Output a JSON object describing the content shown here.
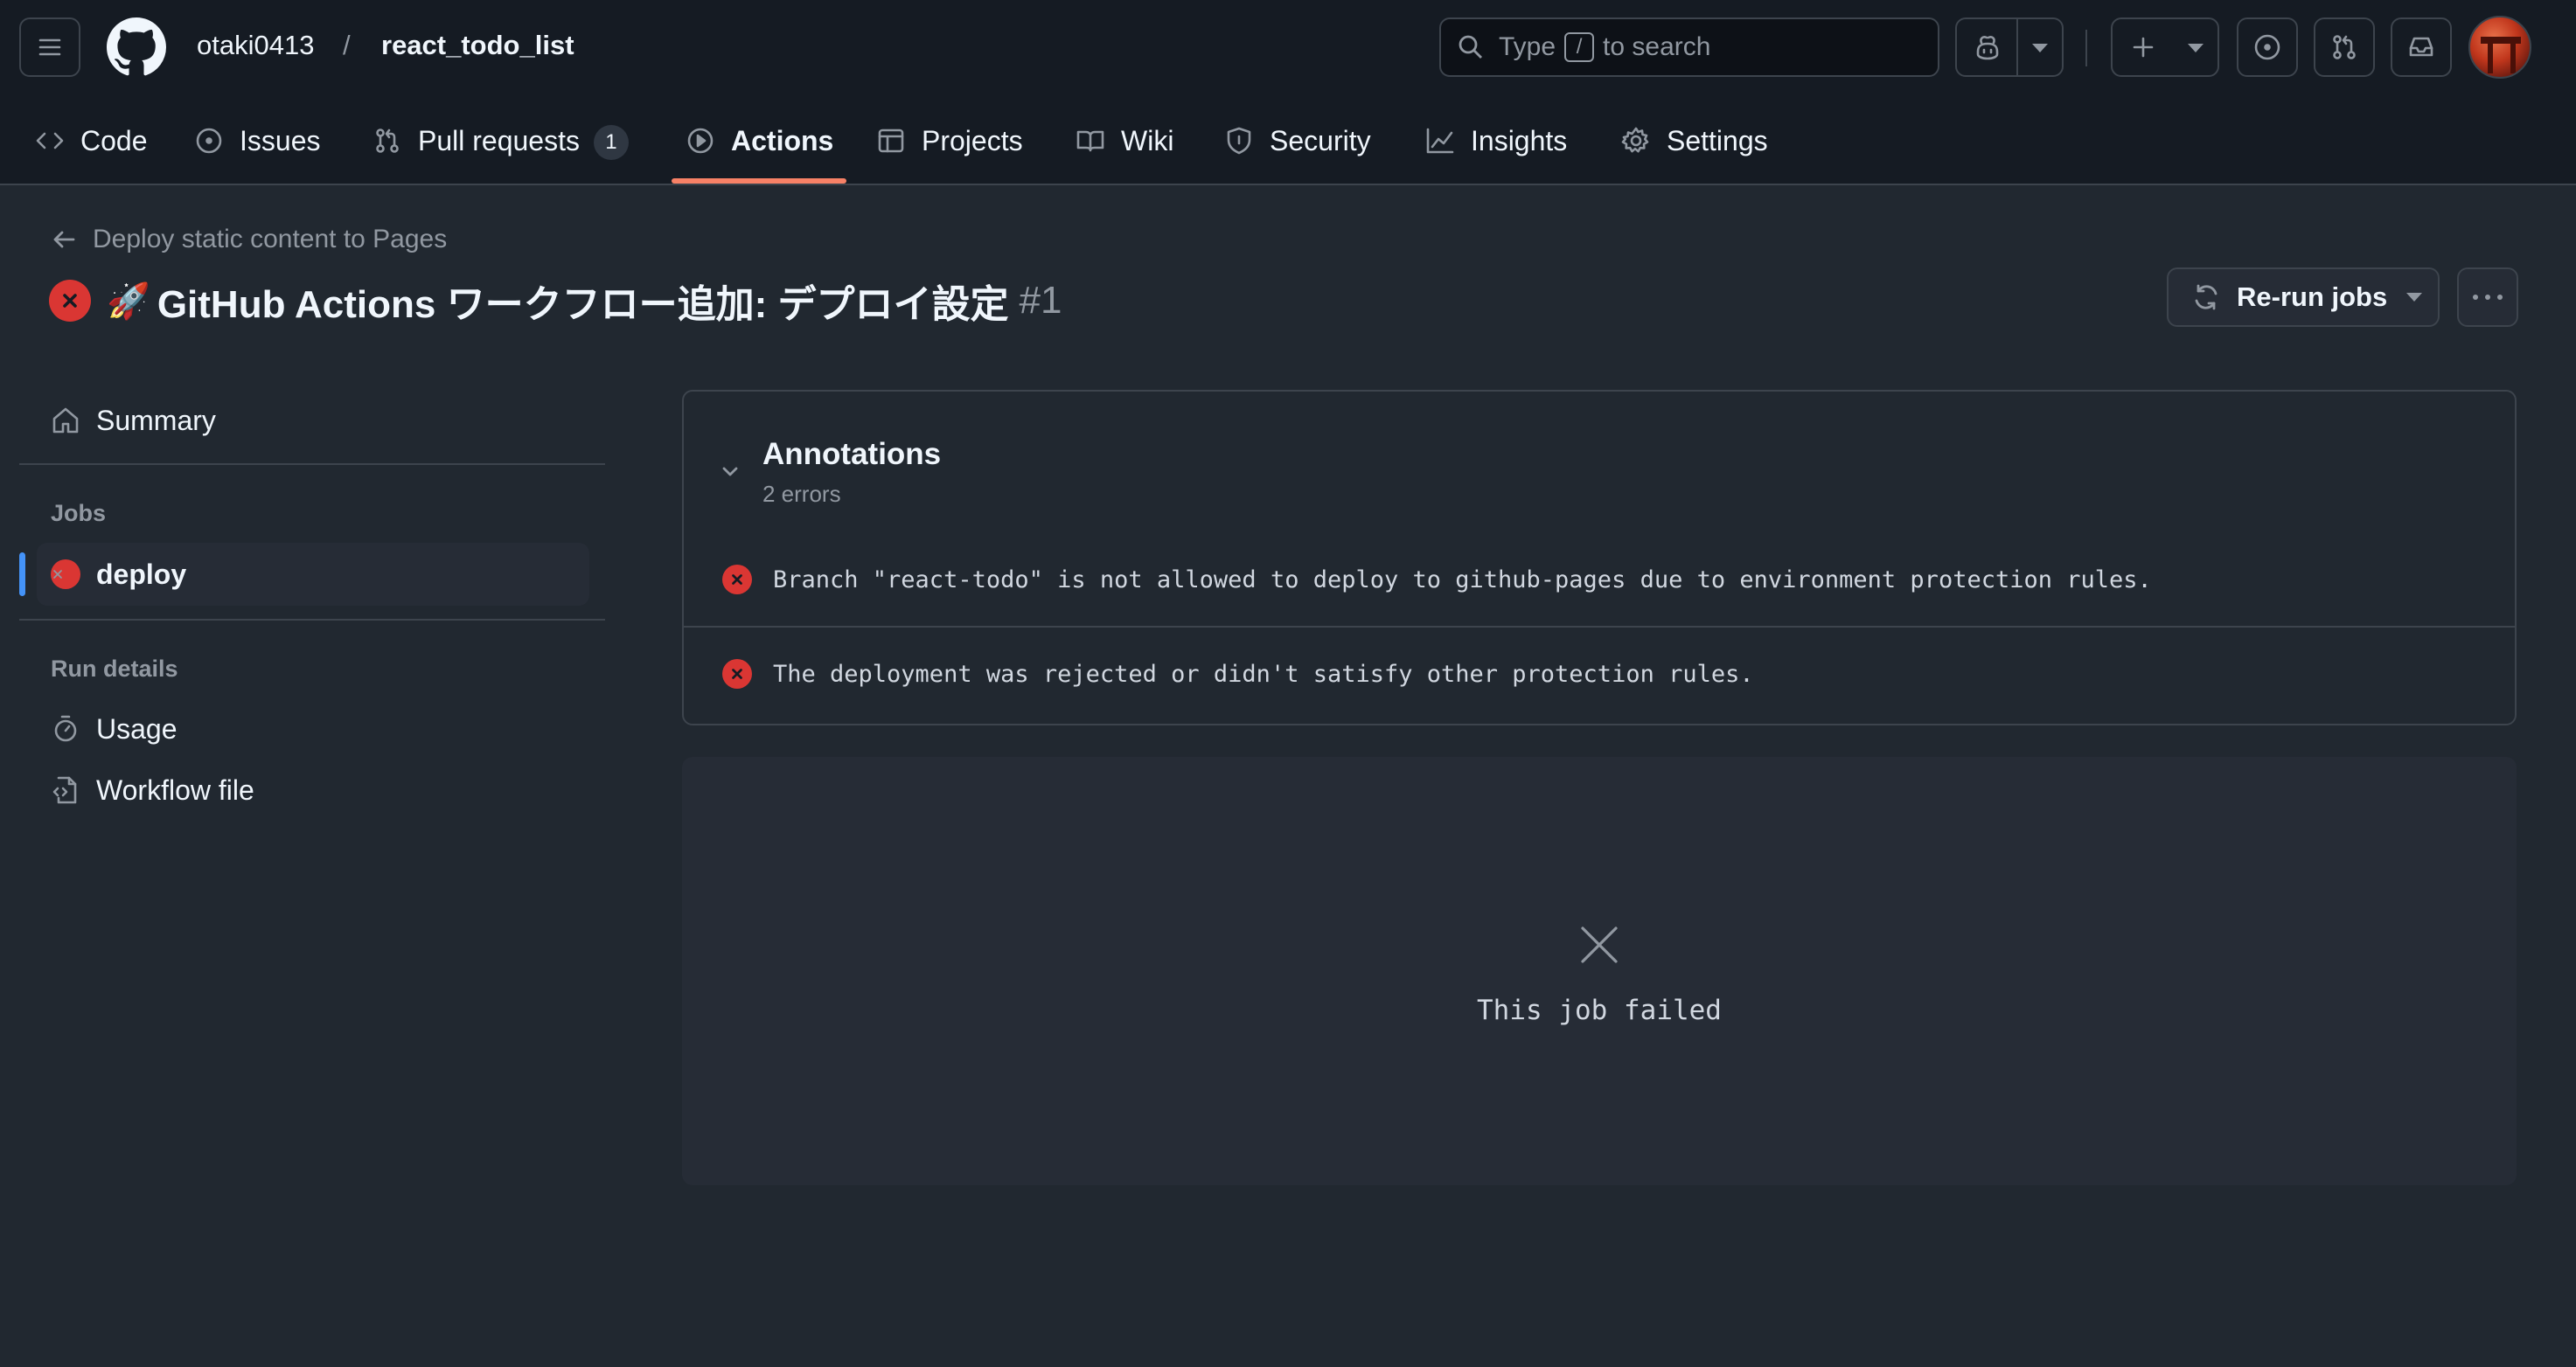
{
  "header": {
    "owner": "otaki0413",
    "separator": "/",
    "repo": "react_todo_list",
    "search": {
      "prefix": "Type",
      "key": "/",
      "suffix": "to search"
    }
  },
  "tabs": [
    {
      "label": "Code",
      "icon": "code-icon"
    },
    {
      "label": "Issues",
      "icon": "issue-icon"
    },
    {
      "label": "Pull requests",
      "icon": "pull-request-icon",
      "count": "1"
    },
    {
      "label": "Actions",
      "icon": "play-icon",
      "active": true
    },
    {
      "label": "Projects",
      "icon": "table-icon"
    },
    {
      "label": "Wiki",
      "icon": "book-icon"
    },
    {
      "label": "Security",
      "icon": "shield-icon"
    },
    {
      "label": "Insights",
      "icon": "graph-icon"
    },
    {
      "label": "Settings",
      "icon": "gear-icon"
    }
  ],
  "run": {
    "back_link": "Deploy static content to Pages",
    "emoji": "🚀",
    "title": "GitHub Actions ワークフロー追加: デプロイ設定",
    "number": "#1",
    "status": "failure",
    "rerun_label": "Re-run jobs"
  },
  "sidebar": {
    "summary": "Summary",
    "jobs_heading": "Jobs",
    "job": "deploy",
    "run_details_heading": "Run details",
    "usage": "Usage",
    "workflow_file": "Workflow file"
  },
  "annotations": {
    "title": "Annotations",
    "subtitle": "2 errors",
    "items": [
      "Branch \"react-todo\" is not allowed to deploy to github-pages due to environment protection rules.",
      "The deployment was rejected or didn't satisfy other protection rules."
    ]
  },
  "job_panel": {
    "message": "This job failed"
  },
  "colors": {
    "background": "#212830",
    "header": "#151b23",
    "border": "#3d444d",
    "error": "#da3633",
    "accent_underline": "#f78166",
    "active_indicator": "#4493f8"
  }
}
